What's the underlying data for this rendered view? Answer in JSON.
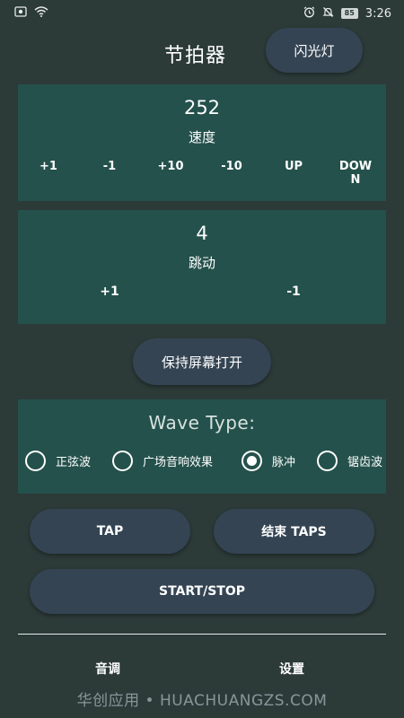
{
  "status_bar": {
    "battery": "85",
    "time": "3:26"
  },
  "header": {
    "title": "节拍器",
    "flash_label": "闪光灯"
  },
  "speed": {
    "value": "252",
    "label": "速度",
    "buttons": [
      "+1",
      "-1",
      "+10",
      "-10",
      "UP",
      "DOW\nN"
    ]
  },
  "beat": {
    "value": "4",
    "label": "跳动",
    "buttons": [
      "+1",
      "-1"
    ]
  },
  "keep_screen_label": "保持屏幕打开",
  "wave": {
    "title": "Wave Type:",
    "options": [
      {
        "label": "正弦波",
        "selected": false
      },
      {
        "label": "广场音响效果",
        "selected": false
      },
      {
        "label": "脉冲",
        "selected": true
      },
      {
        "label": "锯齿波",
        "selected": false
      }
    ]
  },
  "actions": {
    "tap": "TAP",
    "end_taps": "结束 TAPS",
    "start_stop": "START/STOP"
  },
  "bottom_nav": {
    "tone": "音调",
    "settings": "设置"
  },
  "watermark": "华创应用 • HUACHUANGZS.COM",
  "colors": {
    "background": "#2c3a38",
    "panel": "#24514c",
    "button": "#344453",
    "text": "#ffffff"
  }
}
